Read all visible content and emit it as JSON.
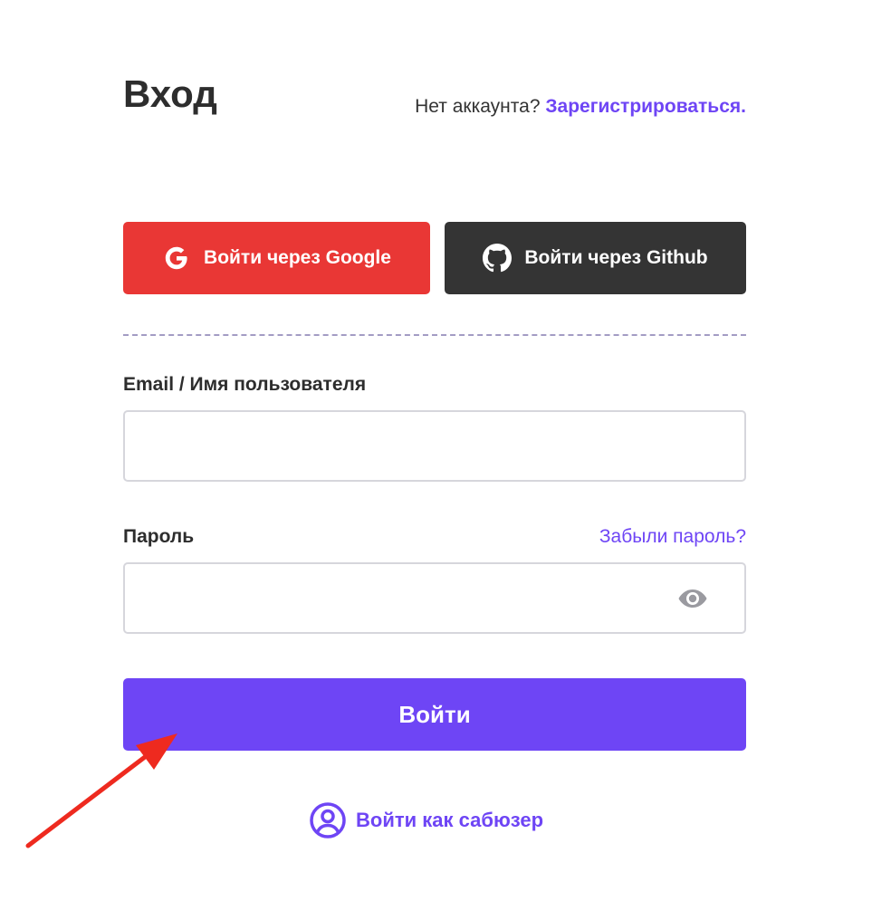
{
  "header": {
    "title": "Вход",
    "signup_prompt": "Нет аккаунта?",
    "signup_link": "Зарегистрироваться."
  },
  "oauth": {
    "google_label": "Войти через Google",
    "github_label": "Войти через Github"
  },
  "form": {
    "email_label": "Email / Имя пользователя",
    "email_value": "",
    "password_label": "Пароль",
    "password_value": "",
    "forgot_link": "Забыли пароль?",
    "submit_label": "Войти"
  },
  "subuser": {
    "label": "Войти как сабюзер"
  },
  "icons": {
    "google": "google-icon",
    "github": "github-icon",
    "eye": "eye-icon",
    "user": "user-circle-icon",
    "annotation": "red-arrow-annotation"
  },
  "colors": {
    "accent": "#6e45f5",
    "google": "#e93735",
    "github": "#343434",
    "annotation": "#ee2a1f"
  }
}
